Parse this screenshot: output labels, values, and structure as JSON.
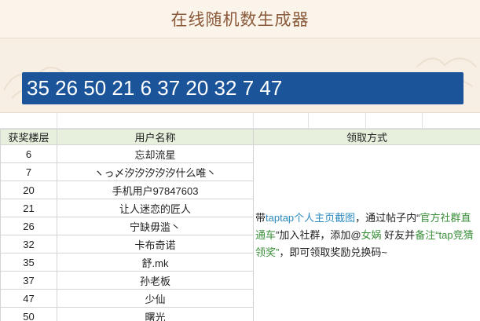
{
  "header": {
    "title": "在线随机数生成器"
  },
  "result": {
    "numbers": "35 26 50 21 6 37 20 32 7 47"
  },
  "table": {
    "headers": {
      "floor": "获奖楼层",
      "user": "用户名称",
      "method": "领取方式"
    },
    "rows": [
      {
        "floor": "6",
        "user": "忘却流星"
      },
      {
        "floor": "7",
        "user": "ヽっ〆汐汐汐汐汐什么唯丶"
      },
      {
        "floor": "20",
        "user": "手机用户97847603"
      },
      {
        "floor": "21",
        "user": "让人迷恋的匠人"
      },
      {
        "floor": "26",
        "user": "宁缺毋滥丶"
      },
      {
        "floor": "32",
        "user": "卡布奇诺"
      },
      {
        "floor": "35",
        "user": "舒.mk"
      },
      {
        "floor": "37",
        "user": "孙老板"
      },
      {
        "floor": "47",
        "user": "少仙"
      },
      {
        "floor": "50",
        "user": "曙光"
      }
    ],
    "method": {
      "p1": "带",
      "p2": "taptap个人主页截图",
      "p3": "，通过帖子内“",
      "p4": "官方社群直通车",
      "p5": "”加入社群，添加@",
      "p6": "女娲",
      "p7": " 好友并",
      "p8": "备注",
      "p9": "“tap竞猜领奖”",
      "p10": "，即可领取奖励兑换码~"
    }
  },
  "colors": {
    "number_box": "#1b5498",
    "header_bg": "#e6f0dd",
    "title": "#8a5a3a",
    "link_blue": "#2e8bc0",
    "link_green": "#3b8f3b"
  }
}
